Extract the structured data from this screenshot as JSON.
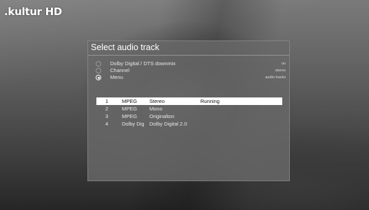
{
  "channel": {
    "logo_text": ".kultur HD"
  },
  "dialog": {
    "title": "Select audio track",
    "options": [
      {
        "label": "Dolby Digital / DTS downmix",
        "value": "on",
        "selected": false
      },
      {
        "label": "Channel",
        "value": "stereo",
        "selected": false
      },
      {
        "label": "Menu",
        "value": "audio tracks",
        "selected": true
      }
    ],
    "tracks": [
      {
        "num": "1",
        "codec": "MPEG",
        "desc": "Stereo",
        "status": "Running",
        "selected": true
      },
      {
        "num": "2",
        "codec": "MPEG",
        "desc": "Mono",
        "status": "",
        "selected": false
      },
      {
        "num": "3",
        "codec": "MPEG",
        "desc": "Originalton",
        "status": "",
        "selected": false
      },
      {
        "num": "4",
        "codec": "Dolby Dig",
        "desc": "Dolby Digital 2.0",
        "status": "",
        "selected": false
      }
    ]
  }
}
